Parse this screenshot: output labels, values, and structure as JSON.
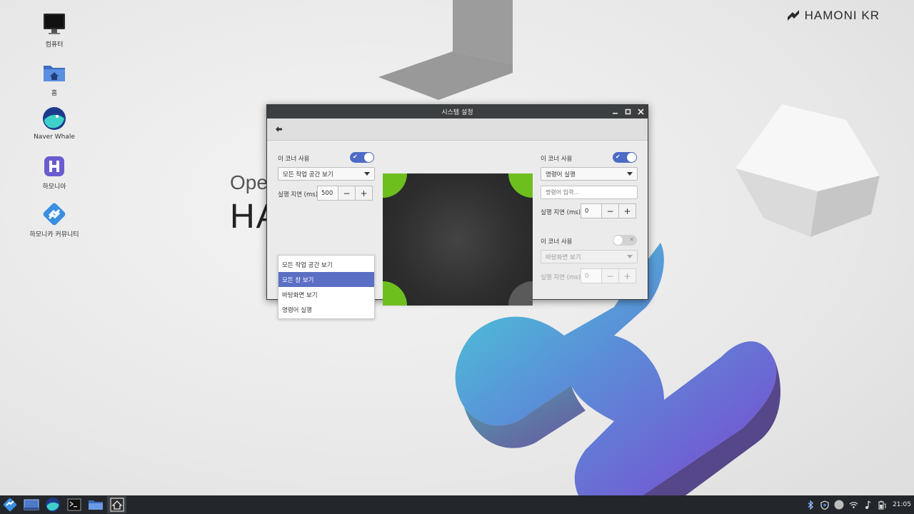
{
  "wallpaper": {
    "brand": "HAMONI KR",
    "text_line1": "Ope",
    "text_line2": "HA"
  },
  "desktop": {
    "icons": [
      {
        "label": "컴퓨터",
        "icon": "computer-icon"
      },
      {
        "label": "홈",
        "icon": "home-folder-icon"
      },
      {
        "label": "Naver Whale",
        "icon": "naver-whale-icon"
      },
      {
        "label": "하모니아",
        "icon": "hamonia-icon"
      },
      {
        "label": "하모니카 커뮤니티",
        "icon": "hamonikr-community-icon"
      }
    ]
  },
  "window": {
    "title": "시스템 설정",
    "controls": [
      "minimize-icon",
      "maximize-icon",
      "close-icon"
    ],
    "top_left": {
      "enable_label": "이 코너 사용",
      "enabled": true,
      "action": "모든 작업 공간 보기",
      "delay_label": "실행 지연 (ms)",
      "delay_value": "500",
      "menu_options": [
        "모든 작업 공간 보기",
        "모든 창 보기",
        "바탕화면 보기",
        "명령어 실행"
      ],
      "menu_selected": "모든 창 보기"
    },
    "top_right": {
      "enable_label": "이 코너 사용",
      "enabled": true,
      "action": "명령어 실행",
      "command_placeholder": "명령어 입력...",
      "delay_label": "실행 지연 (ms)",
      "delay_value": "0"
    },
    "bottom_right": {
      "enable_label": "이 코너 사용",
      "enabled": false,
      "action": "바탕화면 보기",
      "delay_label": "실행 지연 (ms)",
      "delay_value": "0"
    },
    "spin_minus": "−",
    "spin_plus": "+",
    "colors": {
      "accent": "#4d6bc6",
      "corner_active": "#6dbf1e",
      "corner_inactive": "#5a5a5a"
    }
  },
  "taskbar": {
    "apps": [
      "hamonikr-menu-icon",
      "show-desktop-icon",
      "naver-whale-icon",
      "terminal-icon",
      "file-manager-icon",
      "system-settings-icon"
    ],
    "tray": [
      "bluetooth-icon",
      "shield-icon",
      "user-icon",
      "wifi-icon",
      "sound-icon",
      "battery-icon"
    ],
    "clock": "21:05"
  }
}
